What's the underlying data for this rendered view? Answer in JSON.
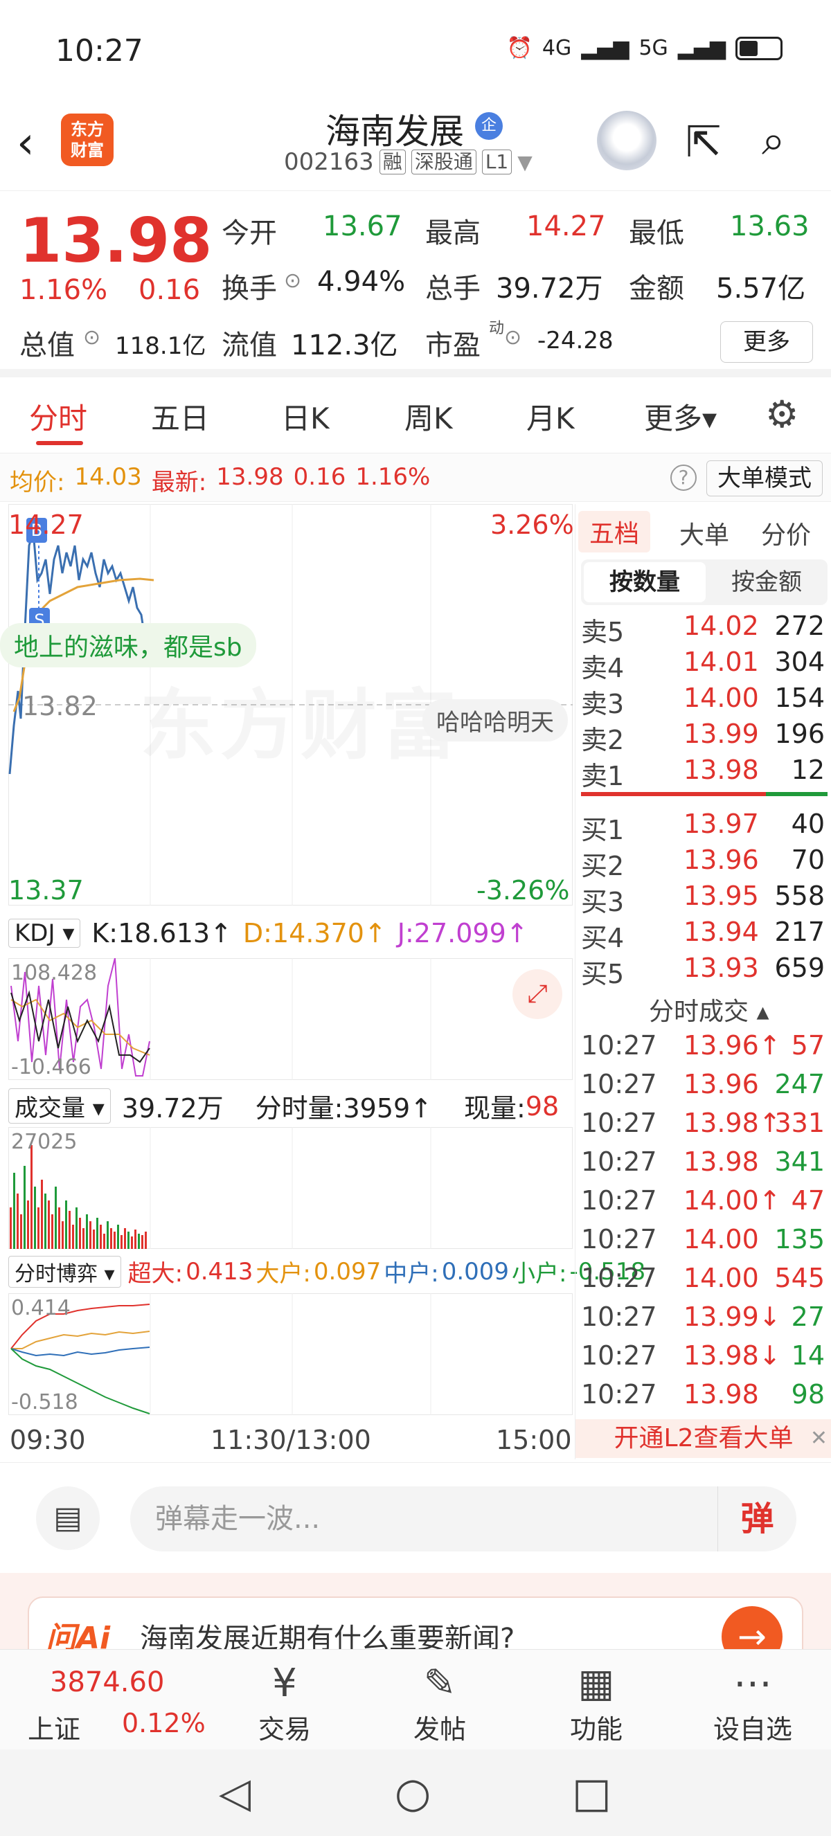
{
  "status_bar": {
    "time": "10:27",
    "net1": "4G",
    "net2": "5G"
  },
  "header": {
    "back_icon": "‹",
    "logo_line1": "东方",
    "logo_line2": "财富",
    "stock_name": "海南发展",
    "badge": "企",
    "stock_code": "002163",
    "tag_rong": "融",
    "tag_sgt": "深股通",
    "tag_l1": "L1"
  },
  "quote": {
    "price": "13.98",
    "change_pct": "1.16%",
    "change": "0.16",
    "open_label": "今开",
    "open": "13.67",
    "high_label": "最高",
    "high": "14.27",
    "low_label": "最低",
    "low": "13.63",
    "turnover_label": "换手",
    "turnover": "4.94%",
    "volume_label": "总手",
    "volume": "39.72万",
    "amount_label": "金额",
    "amount": "5.57亿",
    "mcap_label": "总值",
    "mcap": "118.1亿",
    "float_label": "流值",
    "float": "112.3亿",
    "pe_label": "市盈",
    "pe_sup": "动",
    "pe": "-24.28",
    "more_btn": "更多"
  },
  "tabs": [
    "分时",
    "五日",
    "日K",
    "周K",
    "月K",
    "更多▾"
  ],
  "avg_bar": {
    "avg_label": "均价:",
    "avg": "14.03",
    "latest_label": "最新:",
    "latest": "13.98",
    "chg": "0.16",
    "pct": "1.16%",
    "mode_btn": "大单模式",
    "help": "?"
  },
  "chart": {
    "high": "14.27",
    "high_pct": "3.26%",
    "mid": "13.82",
    "low": "13.37",
    "low_pct": "-3.26%",
    "watermark": "东方财富",
    "danmaku1": "地上的滋味，都是sb",
    "danmaku2": "哈哈哈明天",
    "marker_b": "B",
    "marker_s": "S"
  },
  "kdj": {
    "name": "KDJ",
    "k": "K:18.613↑",
    "d": "D:14.370↑",
    "j": "J:27.099↑",
    "max": "108.428",
    "min": "-10.466"
  },
  "volume_panel": {
    "name": "成交量",
    "total": "39.72万",
    "minute": "分时量:3959↑",
    "now_label": "现量:",
    "now": "98",
    "max": "27025"
  },
  "flow": {
    "name": "分时博弈",
    "super_label": "超大:",
    "super": "0.413",
    "big_label": "大户:",
    "big": "0.097",
    "mid_label": "中户:",
    "mid": "0.009",
    "small_label": "小户:",
    "small": "-0.518",
    "max": "0.414",
    "min": "-0.518"
  },
  "time_axis": [
    "09:30",
    "11:30/13:00",
    "15:00"
  ],
  "side": {
    "tabs": [
      "五档",
      "大单",
      "分价"
    ],
    "toggle_on": "按数量",
    "toggle_off": "按金额",
    "sells": [
      {
        "label": "卖5",
        "price": "14.02",
        "vol": "272"
      },
      {
        "label": "卖4",
        "price": "14.01",
        "vol": "304"
      },
      {
        "label": "卖3",
        "price": "14.00",
        "vol": "154"
      },
      {
        "label": "卖2",
        "price": "13.99",
        "vol": "196"
      },
      {
        "label": "卖1",
        "price": "13.98",
        "vol": "12"
      }
    ],
    "buys": [
      {
        "label": "买1",
        "price": "13.97",
        "vol": "40"
      },
      {
        "label": "买2",
        "price": "13.96",
        "vol": "70"
      },
      {
        "label": "买3",
        "price": "13.95",
        "vol": "558"
      },
      {
        "label": "买4",
        "price": "13.94",
        "vol": "217"
      },
      {
        "label": "买5",
        "price": "13.93",
        "vol": "659"
      }
    ],
    "trades_title": "分时成交 ▴",
    "trades": [
      {
        "t": "10:27",
        "p": "13.96↑",
        "v": "57"
      },
      {
        "t": "10:27",
        "p": "13.96",
        "v": "247"
      },
      {
        "t": "10:27",
        "p": "13.98↑",
        "v": "331"
      },
      {
        "t": "10:27",
        "p": "13.98",
        "v": "341"
      },
      {
        "t": "10:27",
        "p": "14.00↑",
        "v": "47"
      },
      {
        "t": "10:27",
        "p": "14.00",
        "v": "135"
      },
      {
        "t": "10:27",
        "p": "14.00",
        "v": "545"
      },
      {
        "t": "10:27",
        "p": "13.99↓",
        "v": "27"
      },
      {
        "t": "10:27",
        "p": "13.98↓",
        "v": "14"
      },
      {
        "t": "10:27",
        "p": "13.98",
        "v": "98"
      }
    ],
    "l2_banner": "开通L2查看大单",
    "l2_close": "✕"
  },
  "comment_bar": {
    "placeholder": "弹幕走一波...",
    "dan": "弹"
  },
  "ai": {
    "logo": "问Ai",
    "question": "海南发展近期有什么重要新闻?",
    "go": "→"
  },
  "bottom_nav": {
    "index_value": "3874.60",
    "index_name": "上证",
    "index_pct": "0.12%",
    "items": [
      {
        "icon": "¥",
        "label": "交易"
      },
      {
        "icon": "✎",
        "label": "发帖"
      },
      {
        "icon": "▦",
        "label": "功能"
      },
      {
        "icon": "⋯",
        "label": "设自选"
      }
    ]
  },
  "sys_nav": {
    "back": "◁",
    "home": "○",
    "recent": "□"
  }
}
